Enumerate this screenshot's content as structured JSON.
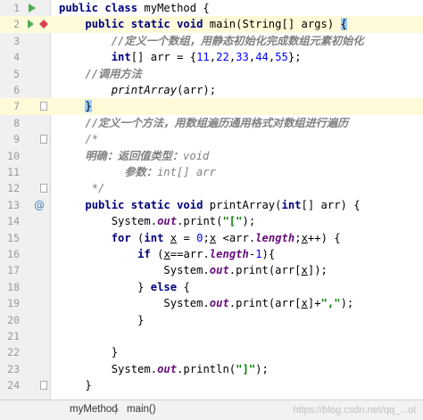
{
  "lines": [
    {
      "n": "1"
    },
    {
      "n": "2"
    },
    {
      "n": "3"
    },
    {
      "n": "4"
    },
    {
      "n": "5"
    },
    {
      "n": "6"
    },
    {
      "n": "7"
    },
    {
      "n": "8"
    },
    {
      "n": "9"
    },
    {
      "n": "10"
    },
    {
      "n": "11"
    },
    {
      "n": "12"
    },
    {
      "n": "13"
    },
    {
      "n": "14"
    },
    {
      "n": "15"
    },
    {
      "n": "16"
    },
    {
      "n": "17"
    },
    {
      "n": "18"
    },
    {
      "n": "19"
    },
    {
      "n": "20"
    },
    {
      "n": "21"
    },
    {
      "n": "22"
    },
    {
      "n": "23"
    },
    {
      "n": "24"
    }
  ],
  "code": {
    "l1": {
      "kw1": "public class",
      "name": " myMethod {"
    },
    "l2": {
      "kw1": "public static void",
      "name": " main(String[] args) ",
      "brace": "{"
    },
    "l3": {
      "text": "//定义一个数组，用静态初始化完成数组元素初始化"
    },
    "l4": {
      "kw1": "int",
      "mid": "[] arr = {",
      "n1": "11",
      "c1": ",",
      "n2": "22",
      "c2": ",",
      "n3": "33",
      "c3": ",",
      "n4": "44",
      "c4": ",",
      "n5": "55",
      "end": "};"
    },
    "l5": {
      "text": "//调用方法"
    },
    "l6": {
      "call": "printArray",
      "rest": "(arr);"
    },
    "l7": {
      "brace": "}"
    },
    "l8": {
      "text": "//定义一个方法，用数组遍历通用格式对数组进行遍历"
    },
    "l9": {
      "text": "/*"
    },
    "l10": {
      "bold": "明确：返回值类型：",
      "tail": "void"
    },
    "l11": {
      "bold": "参数：",
      "tail": "int[] arr"
    },
    "l12": {
      "text": "*/"
    },
    "l13": {
      "kw1": "public static void",
      "name": " printArray(",
      "kw2": "int",
      "rest": "[] arr) {"
    },
    "l14": {
      "a": "System.",
      "fld": "out",
      "b": ".print(",
      "str": "\"[\"",
      "c": ");"
    },
    "l15": {
      "kw1": "for",
      "a": " (",
      "kw2": "int",
      "b": " ",
      "v1": "x",
      "c": " = ",
      "num": "0",
      "d": ";",
      "v2": "x",
      "e": " <arr.",
      "fld": "length",
      "f": ";",
      "v3": "x",
      "g": "++) {"
    },
    "l16": {
      "kw1": "if",
      "a": " (",
      "v1": "x",
      "b": "==arr.",
      "fld": "length",
      "c": "-",
      "num": "1",
      "d": "){"
    },
    "l17": {
      "a": "System.",
      "fld": "out",
      "b": ".print(arr[",
      "v1": "x",
      "c": "]);"
    },
    "l18": {
      "a": "} ",
      "kw1": "else",
      "b": " {"
    },
    "l19": {
      "a": "System.",
      "fld": "out",
      "b": ".print(arr[",
      "v1": "x",
      "c": "]+",
      "str": "\",\"",
      "d": ");"
    },
    "l20": {
      "a": "}"
    },
    "l21": {
      "a": ""
    },
    "l22": {
      "a": "}"
    },
    "l23": {
      "a": "System.",
      "fld": "out",
      "b": ".println(",
      "str": "\"]\"",
      "c": ");"
    },
    "l24": {
      "a": "}"
    }
  },
  "status": {
    "crumb1": "myMethod",
    "sep": "〉",
    "crumb2": "main()",
    "watermark": "https://blog.csdn.net/qq_...ol"
  },
  "colors": {
    "run": "#4caf50",
    "breakpoint": "#d9434f",
    "override": "#4a7dbf"
  }
}
